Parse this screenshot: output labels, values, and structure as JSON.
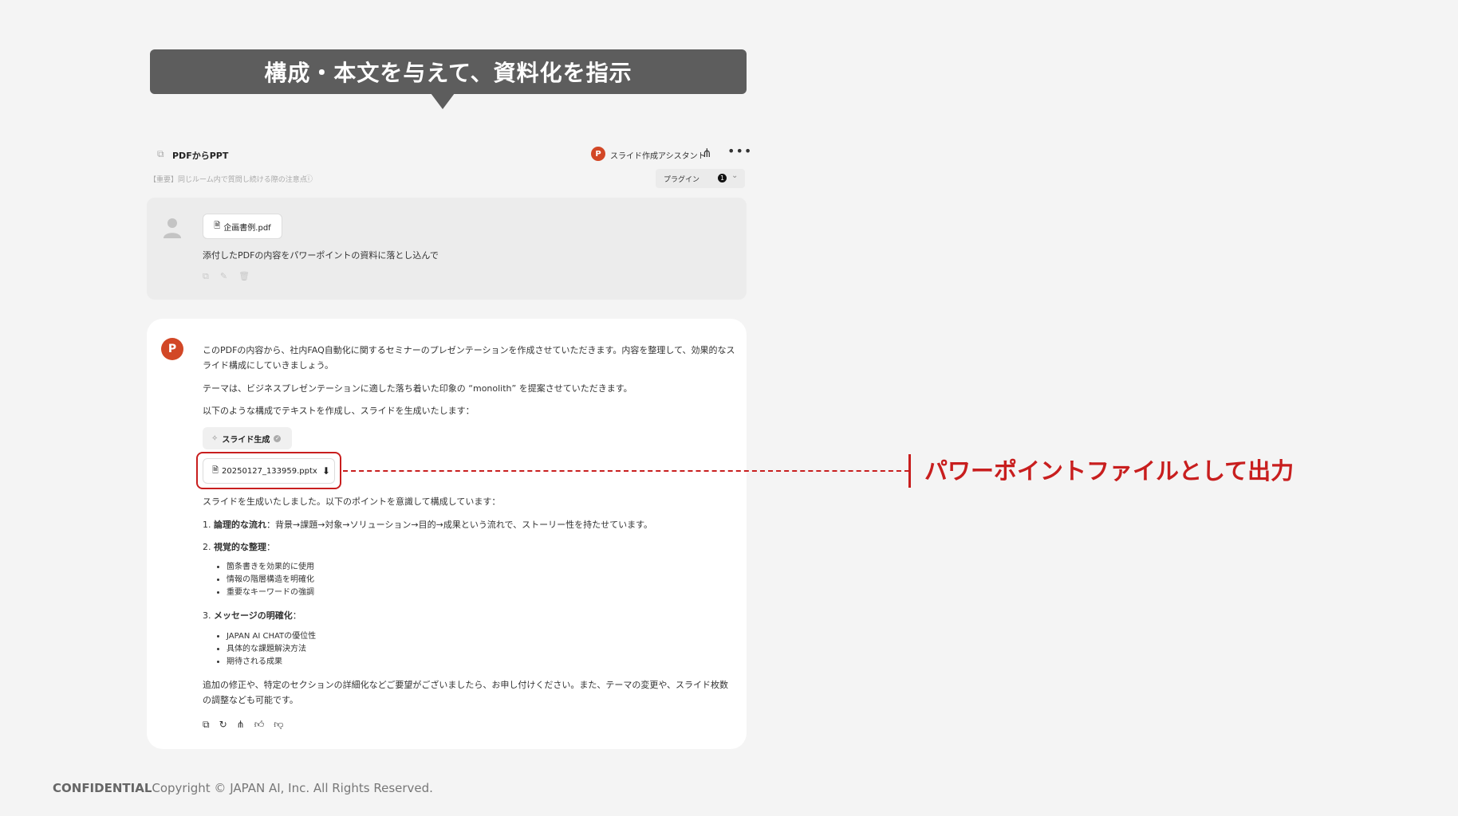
{
  "banner": {
    "title": "構成・本文を与えて、資料化を指示"
  },
  "top_bar": {
    "chat_title": "PDFからPPT",
    "assistant_name": "スライド作成アシスタント",
    "assistant_badge": "P",
    "notice": "【重要】同じルーム内で質問し続ける際の注意点",
    "plugin_label": "プラグイン",
    "plugin_count": "1"
  },
  "user_message": {
    "attachment": "企画書例.pdf",
    "text": "添付したPDFの内容をパワーポイントの資料に落とし込んで"
  },
  "assistant_message": {
    "para1": "このPDFの内容から、社内FAQ自動化に関するセミナーのプレゼンテーションを作成させていただきます。内容を整理して、効果的なスライド構成にしていきましょう。",
    "para2": "テーマは、ビジネスプレゼンテーションに適した落ち着いた印象の “monolith” を提案させていただきます。",
    "para3": "以下のような構成でテキストを作成し、スライドを生成いたします：",
    "tool_label": "スライド生成",
    "file_name": "20250127_133959.pptx",
    "para4": "スライドを生成いたしました。以下のポイントを意識して構成しています：",
    "points": [
      {
        "num": "1.",
        "title": "論理的な流れ",
        "text": "：背景→課題→対象→ソリューション→目的→成果という流れで、ストーリー性を持たせています。"
      },
      {
        "num": "2.",
        "title": "視覚的な整理",
        "text": "：",
        "bullets": [
          "箇条書きを効果的に使用",
          "情報の階層構造を明確化",
          "重要なキーワードの強調"
        ]
      },
      {
        "num": "3.",
        "title": "メッセージの明確化",
        "text": "：",
        "bullets": [
          "JAPAN AI CHATの優位性",
          "具体的な課題解決方法",
          "期待される成果"
        ]
      }
    ],
    "para5": "追加の修正や、特定のセクションの詳細化などご要望がございましたら、お申し付けください。また、テーマの変更や、スライド枚数の調整なども可能です。"
  },
  "annotation": {
    "text": "パワーポイントファイルとして出力"
  },
  "footer": {
    "confidential": "CONFIDENTIAL",
    "copyright": "Copyright © JAPAN AI, Inc. All Rights Reserved."
  },
  "colors": {
    "accent_red": "#c81e1e",
    "banner_gray": "#5d5d5d",
    "ppt_orange": "#d24726"
  }
}
